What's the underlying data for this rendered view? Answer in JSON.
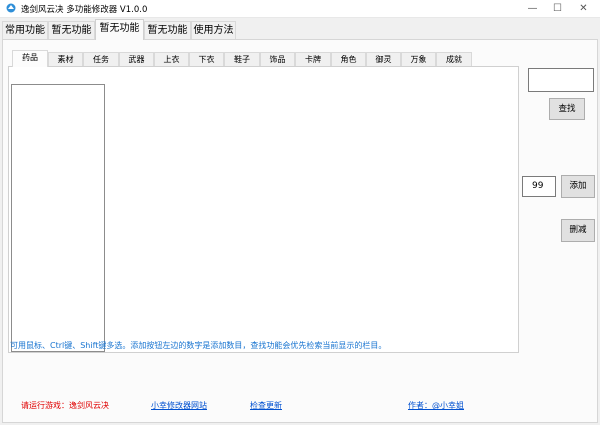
{
  "window": {
    "title": "逸剑风云决 多功能修改器  V1.0.0",
    "minimize_glyph": "—",
    "maximize_glyph": "☐",
    "close_glyph": "✕"
  },
  "main_tabs": [
    {
      "label": "常用功能"
    },
    {
      "label": "暂无功能"
    },
    {
      "label": "暂无功能"
    },
    {
      "label": "暂无功能"
    },
    {
      "label": "使用方法"
    }
  ],
  "sub_tabs": [
    {
      "label": "药品"
    },
    {
      "label": "素材"
    },
    {
      "label": "任务"
    },
    {
      "label": "武器"
    },
    {
      "label": "上衣"
    },
    {
      "label": "下衣"
    },
    {
      "label": "鞋子"
    },
    {
      "label": "饰品"
    },
    {
      "label": "卡牌"
    },
    {
      "label": "角色"
    },
    {
      "label": "御灵"
    },
    {
      "label": "万象"
    },
    {
      "label": "成就"
    }
  ],
  "search": {
    "value": "",
    "button_label": "查找"
  },
  "add": {
    "quantity": "99",
    "button_label": "添加"
  },
  "delete": {
    "button_label": "删减"
  },
  "hint": "可用鼠标、Ctrl键、Shift键多选。添加按钮左边的数字是添加数目，查找功能会优先检索当前显示的栏目。",
  "footer": {
    "run_game": "请运行游戏：逸剑风云决",
    "site_link": "小幸修改器网站",
    "update_link": "检查更新",
    "author": "作者：@小幸姐"
  },
  "colors": {
    "hint": "#1874d0",
    "warning": "#e00000",
    "link": "#0050d0"
  }
}
